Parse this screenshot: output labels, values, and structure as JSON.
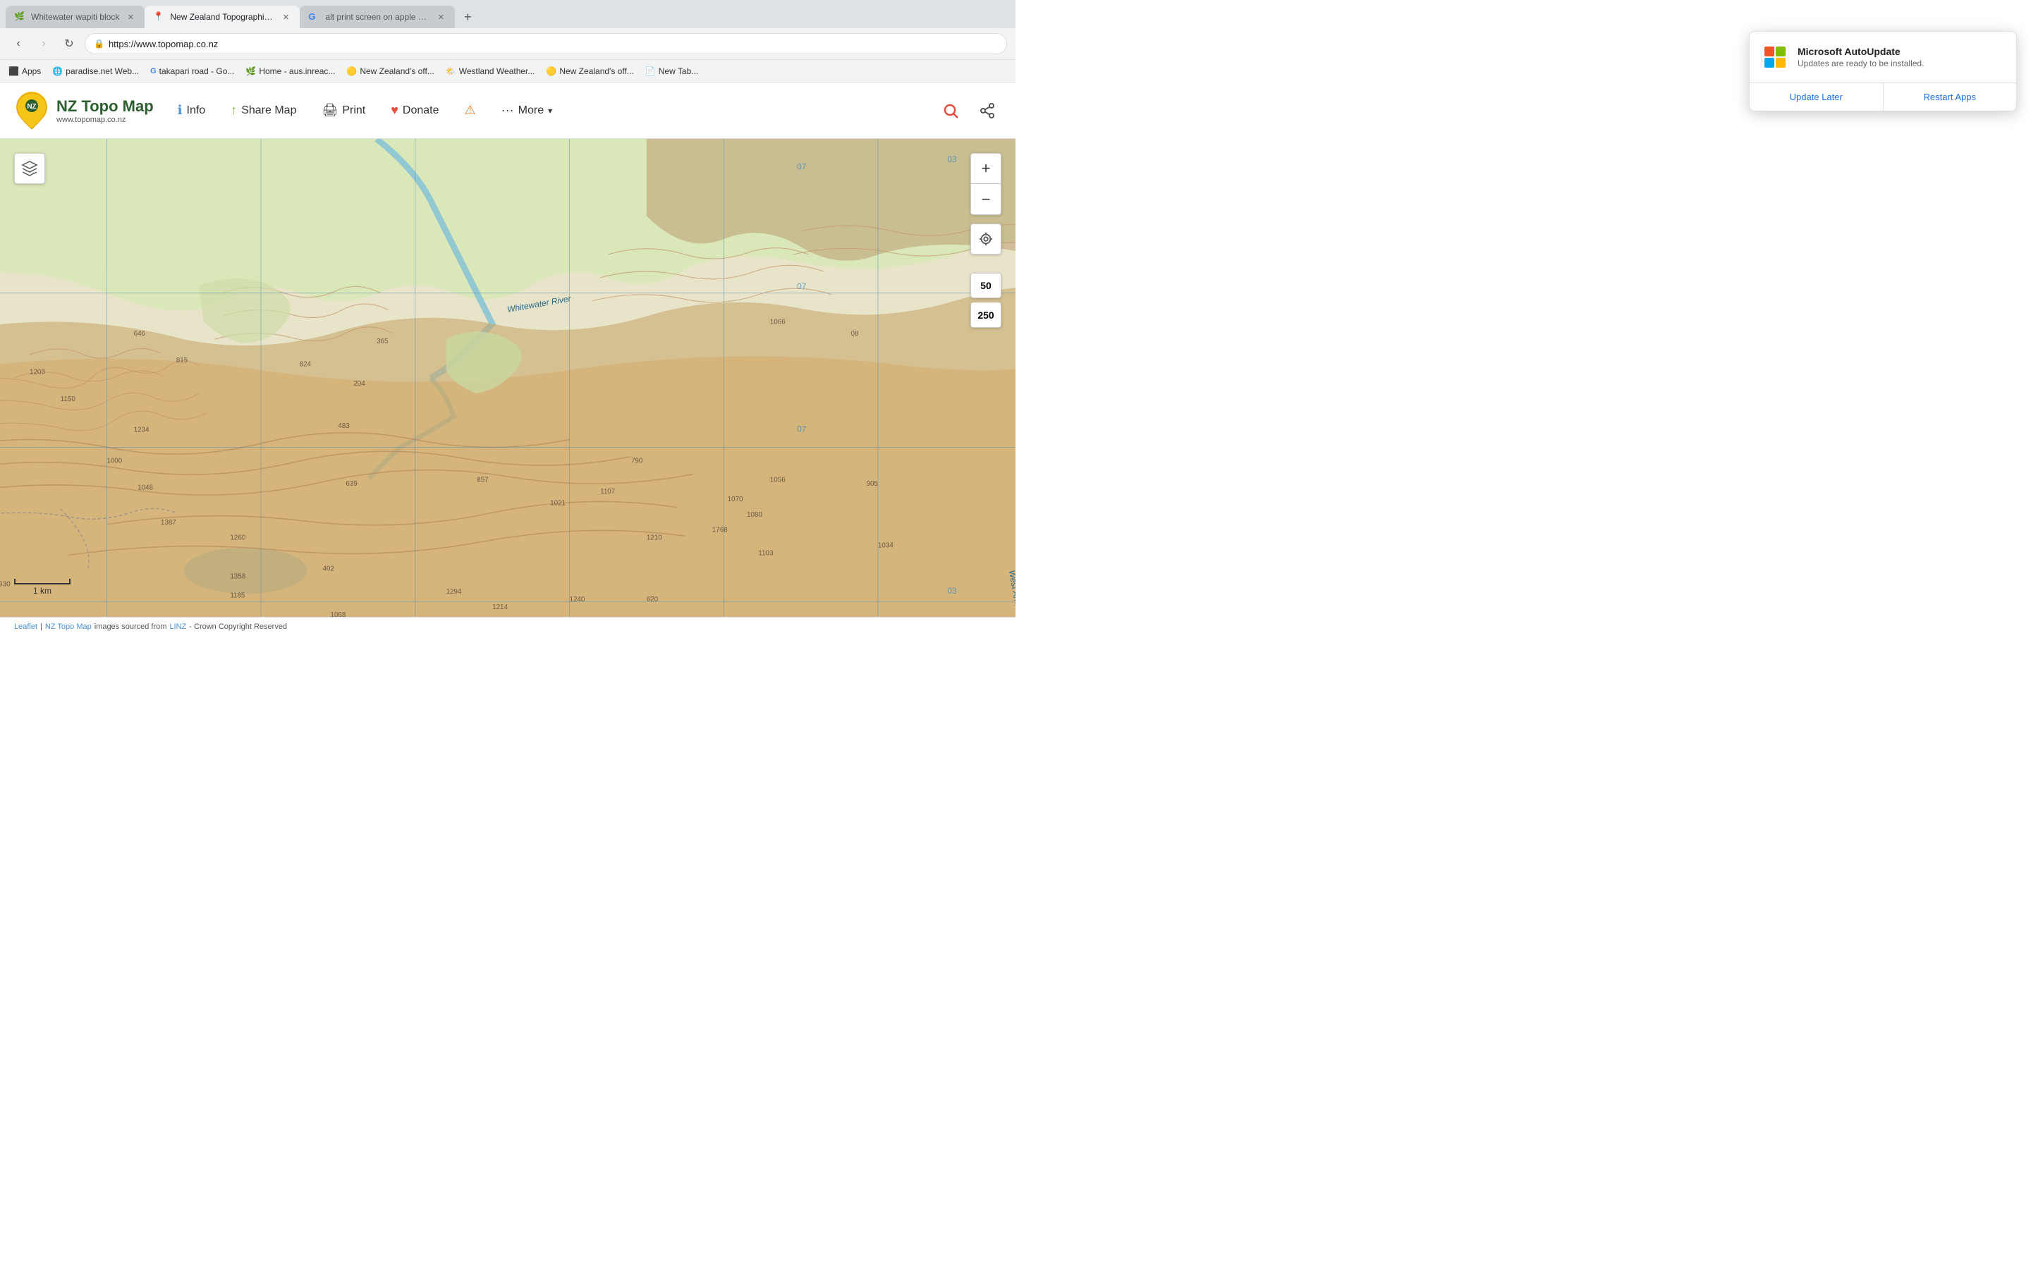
{
  "browser": {
    "tabs": [
      {
        "id": "tab1",
        "favicon": "🌿",
        "title": "Whitewater wapiti block",
        "active": false
      },
      {
        "id": "tab2",
        "favicon": "📍",
        "title": "New Zealand Topographic Map...",
        "active": true
      },
      {
        "id": "tab3",
        "favicon": "G",
        "title": "alt print screen on apple ke...",
        "active": false
      }
    ],
    "new_tab_label": "+",
    "url": "https://www.topomap.co.nz",
    "nav": {
      "back_disabled": false,
      "forward_disabled": true,
      "refresh_label": "↻"
    },
    "bookmarks": [
      {
        "id": "bm1",
        "icon": "🔲",
        "label": "Apps"
      },
      {
        "id": "bm2",
        "icon": "🌐",
        "label": "paradise.net Web..."
      },
      {
        "id": "bm3",
        "icon": "G",
        "label": "takapari road - Go..."
      },
      {
        "id": "bm4",
        "icon": "🌿",
        "label": "Home - aus.inreac..."
      },
      {
        "id": "bm5",
        "icon": "🟡",
        "label": "New Zealand's off..."
      },
      {
        "id": "bm6",
        "icon": "🌤️",
        "label": "Westland Weather..."
      },
      {
        "id": "bm7",
        "icon": "🟡",
        "label": "New Zealand's off..."
      },
      {
        "id": "bm8",
        "icon": "📄",
        "label": "New Tab..."
      }
    ]
  },
  "site": {
    "logo_main": "NZ Topo Map",
    "logo_sub": "www.topomap.co.nz",
    "nav_links": [
      {
        "id": "info",
        "icon": "ℹ️",
        "label": "Info"
      },
      {
        "id": "share",
        "icon": "📤",
        "label": "Share Map"
      },
      {
        "id": "print",
        "icon": "🖨️",
        "label": "Print"
      },
      {
        "id": "donate",
        "icon": "❤️",
        "label": "Donate"
      },
      {
        "id": "alert",
        "icon": "⚠️",
        "label": ""
      },
      {
        "id": "more",
        "icon": "···",
        "label": "More"
      }
    ]
  },
  "map": {
    "scale_50": "50",
    "scale_250": "250",
    "scale_bar_label": "1 km",
    "footer_leaflet": "Leaflet",
    "footer_separator": "|",
    "footer_nztopo": "NZ Topo Map",
    "footer_text": "images sourced from",
    "footer_linz": "LINZ",
    "footer_crown": "- Crown Copyright Reserved",
    "zoom_in": "+",
    "zoom_out": "−",
    "layers_icon": "⊟",
    "location_icon": "⊕"
  },
  "notification": {
    "title": "Microsoft AutoUpdate",
    "subtitle": "Updates are ready to be installed.",
    "btn_later": "Update Later",
    "btn_restart": "Restart Apps"
  }
}
